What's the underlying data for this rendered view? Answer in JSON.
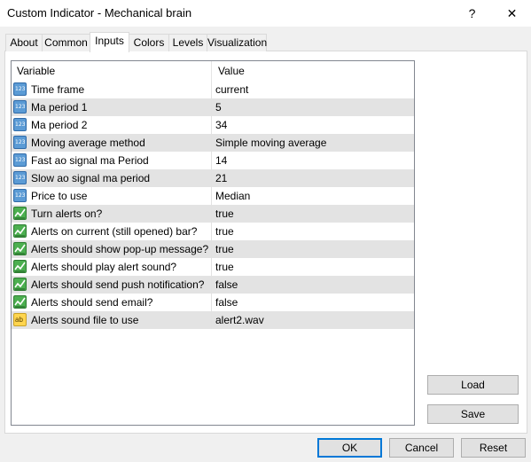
{
  "window": {
    "title": "Custom Indicator - Mechanical brain",
    "help_glyph": "?",
    "close_glyph": "✕"
  },
  "tabs": [
    {
      "label": "About"
    },
    {
      "label": "Common"
    },
    {
      "label": "Inputs",
      "active": true
    },
    {
      "label": "Colors"
    },
    {
      "label": "Levels"
    },
    {
      "label": "Visualization"
    }
  ],
  "grid": {
    "headers": {
      "variable": "Variable",
      "value": "Value"
    },
    "rows": [
      {
        "type": "number",
        "icon": "number-icon",
        "variable": "Time frame",
        "value": "current"
      },
      {
        "type": "number",
        "icon": "number-icon",
        "variable": "Ma period 1",
        "value": "5"
      },
      {
        "type": "number",
        "icon": "number-icon",
        "variable": "Ma period 2",
        "value": "34"
      },
      {
        "type": "number",
        "icon": "number-icon",
        "variable": "Moving average method",
        "value": "Simple moving average"
      },
      {
        "type": "number",
        "icon": "number-icon",
        "variable": "Fast ao signal ma Period",
        "value": "14"
      },
      {
        "type": "number",
        "icon": "number-icon",
        "variable": "Slow ao signal ma period",
        "value": "21"
      },
      {
        "type": "number",
        "icon": "number-icon",
        "variable": "Price to use",
        "value": "Median"
      },
      {
        "type": "bool",
        "icon": "boolean-icon",
        "variable": "Turn alerts on?",
        "value": "true"
      },
      {
        "type": "bool",
        "icon": "boolean-icon",
        "variable": "Alerts on current (still opened) bar?",
        "value": "true"
      },
      {
        "type": "bool",
        "icon": "boolean-icon",
        "variable": "Alerts should show pop-up message?",
        "value": "true"
      },
      {
        "type": "bool",
        "icon": "boolean-icon",
        "variable": "Alerts should play alert sound?",
        "value": "true"
      },
      {
        "type": "bool",
        "icon": "boolean-icon",
        "variable": "Alerts should send push notification?",
        "value": "false"
      },
      {
        "type": "bool",
        "icon": "boolean-icon",
        "variable": "Alerts should send email?",
        "value": "false"
      },
      {
        "type": "string",
        "icon": "string-icon",
        "variable": "Alerts sound file to use",
        "value": "alert2.wav"
      }
    ],
    "number_icon_text": "123",
    "string_icon_text": "ab"
  },
  "side_buttons": {
    "load": "Load",
    "save": "Save"
  },
  "footer": {
    "ok": "OK",
    "cancel": "Cancel",
    "reset": "Reset"
  },
  "colors": {
    "row_alt": "#e3e3e3",
    "accent": "#0078d7"
  }
}
